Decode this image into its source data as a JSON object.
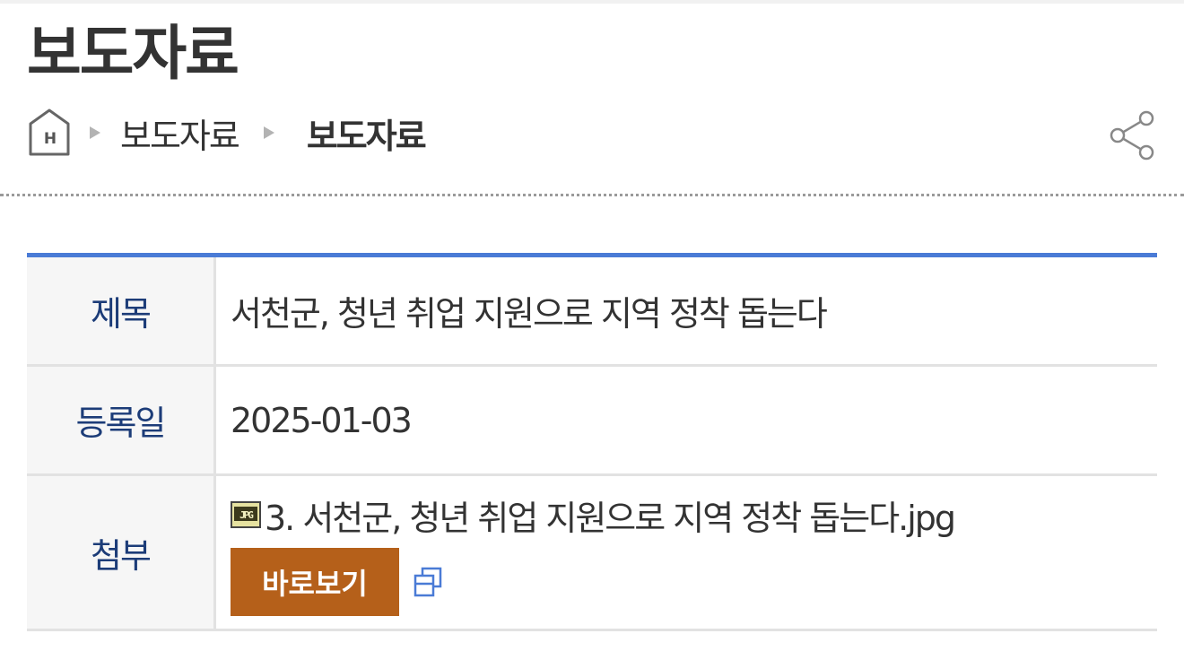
{
  "page": {
    "title": "보도자료"
  },
  "breadcrumb": {
    "home_icon": "home-icon",
    "items": [
      "보도자료",
      "보도자료"
    ]
  },
  "share": {
    "icon": "share-icon"
  },
  "table": {
    "accent_color": "#4a7bd6",
    "header_color": "#1c3c78",
    "title_label": "제목",
    "title_value": "서천군, 청년 취업 지원으로 지역 정착 돕는다",
    "date_label": "등록일",
    "date_value": "2025-01-03",
    "attach_label": "첨부",
    "attachment": {
      "file_icon": "jpg-file-icon",
      "file_name": "3. 서천군, 청년 취업 지원으로 지역 정착 돕는다.jpg",
      "preview_label": "바로보기",
      "preview_color": "#b5601a",
      "new_window_icon": "new-window-icon"
    }
  }
}
